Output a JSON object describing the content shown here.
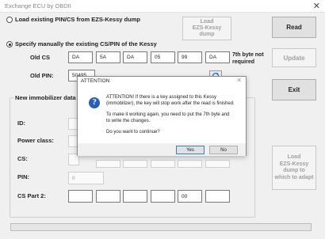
{
  "window": {
    "title": "Exchange ECU by OBDII",
    "close_glyph": "✕"
  },
  "option_dump": {
    "label": "Load existing PIN/CS from EZS-Kessy dump",
    "checked": false
  },
  "load_dump_button": {
    "label_line1": "Load",
    "label_line2": "EZS-Kessy",
    "label_line3": "dump"
  },
  "read_button": {
    "label": "Read"
  },
  "option_manual": {
    "label": "Specify manually the existing CS/PIN of the Kessy",
    "checked": true
  },
  "old_cs": {
    "label": "Old CS",
    "values": [
      "DA",
      "5A",
      "DA",
      "05",
      "99",
      "DA"
    ]
  },
  "seventh_byte_note": {
    "line1": "7th byte not",
    "line2": "required"
  },
  "update_button": {
    "label": "Update"
  },
  "old_pin": {
    "label": "Old PIN:",
    "value": "50495"
  },
  "exit_button": {
    "label": "Exit"
  },
  "new_immobilizer": {
    "title": "New immobilizer data",
    "id_label": "ID:",
    "power_class_label": "Power class:",
    "cs_label": "CS:",
    "pin_label": "PIN:",
    "pin_value": "0",
    "cs_part2_label": "CS Part 2:",
    "cs_part2_values": [
      "",
      "",
      "",
      "",
      "00",
      ""
    ]
  },
  "load_adapt_button": {
    "line1": "Load",
    "line2": "EZS-Kessy",
    "line3": "dump to",
    "line4": "which to adapt"
  },
  "progress": {
    "value": 0
  },
  "message_box": {
    "title": "ATTENTION",
    "close_glyph": "✕",
    "icon": "info-icon",
    "icon_glyph": "?",
    "line1": "ATTENTION! If there is a key assigned to this Kessy",
    "line2": "(immobilizer), the key will stop work after the read is finished.",
    "line3": "To make it working again, you need to put the 7th byte and",
    "line4": "to write the changes.",
    "line5": "Do you want to continue?",
    "yes_label": "Yes",
    "no_label": "No"
  }
}
